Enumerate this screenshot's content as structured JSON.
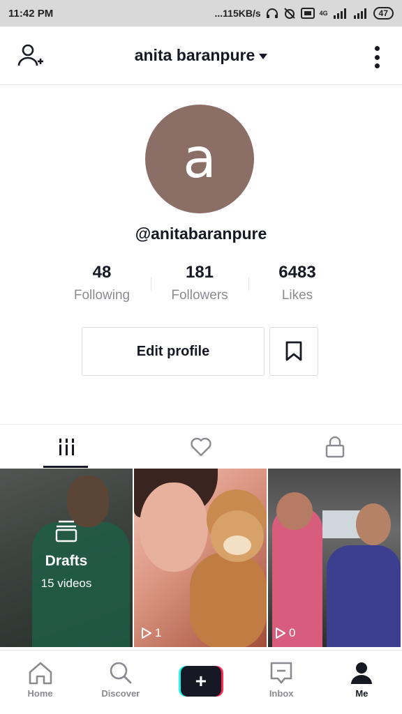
{
  "status_bar": {
    "time": "11:42 PM",
    "network_speed": "...115KB/s",
    "network_type": "4G",
    "battery": "47"
  },
  "header": {
    "title": "anita baranpure",
    "icons": {
      "left": "add-user-icon",
      "right": "more-vertical-icon"
    }
  },
  "profile": {
    "avatar_letter": "a",
    "avatar_color": "#8b6e66",
    "handle": "@anitabaranpure",
    "stats": [
      {
        "value": "48",
        "label": "Following"
      },
      {
        "value": "181",
        "label": "Followers"
      },
      {
        "value": "6483",
        "label": "Likes"
      }
    ],
    "edit_button": "Edit profile",
    "bookmark_icon": "bookmark-icon"
  },
  "tabs": [
    {
      "icon": "grid-icon",
      "active": true
    },
    {
      "icon": "heart-icon",
      "active": false
    },
    {
      "icon": "lock-icon",
      "active": false
    }
  ],
  "videos": [
    {
      "type": "drafts",
      "title": "Drafts",
      "count": "15 videos"
    },
    {
      "type": "video",
      "views": "1"
    },
    {
      "type": "video",
      "views": "0"
    }
  ],
  "nav": {
    "items": [
      {
        "label": "Home",
        "icon": "home-icon"
      },
      {
        "label": "Discover",
        "icon": "search-icon"
      },
      {
        "label": "",
        "icon": "create-plus-icon"
      },
      {
        "label": "Inbox",
        "icon": "inbox-icon"
      },
      {
        "label": "Me",
        "icon": "profile-icon"
      }
    ],
    "active": "Me"
  },
  "colors": {
    "accent_red": "#fe2c55",
    "accent_cyan": "#25f4ee",
    "text_primary": "#161823",
    "text_secondary": "#8a8b91"
  }
}
